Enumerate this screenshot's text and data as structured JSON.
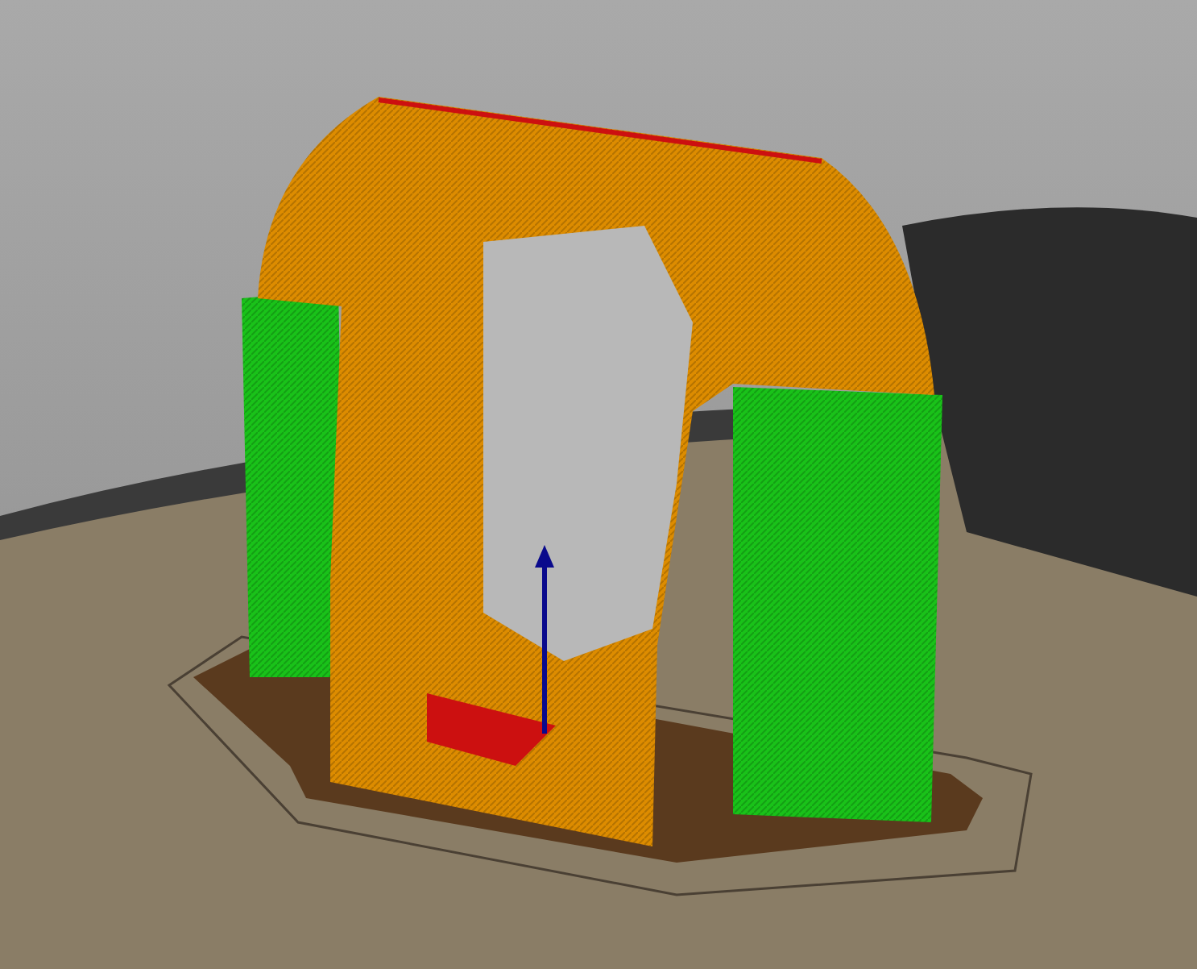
{
  "viewport": {
    "kind": "preview"
  }
}
